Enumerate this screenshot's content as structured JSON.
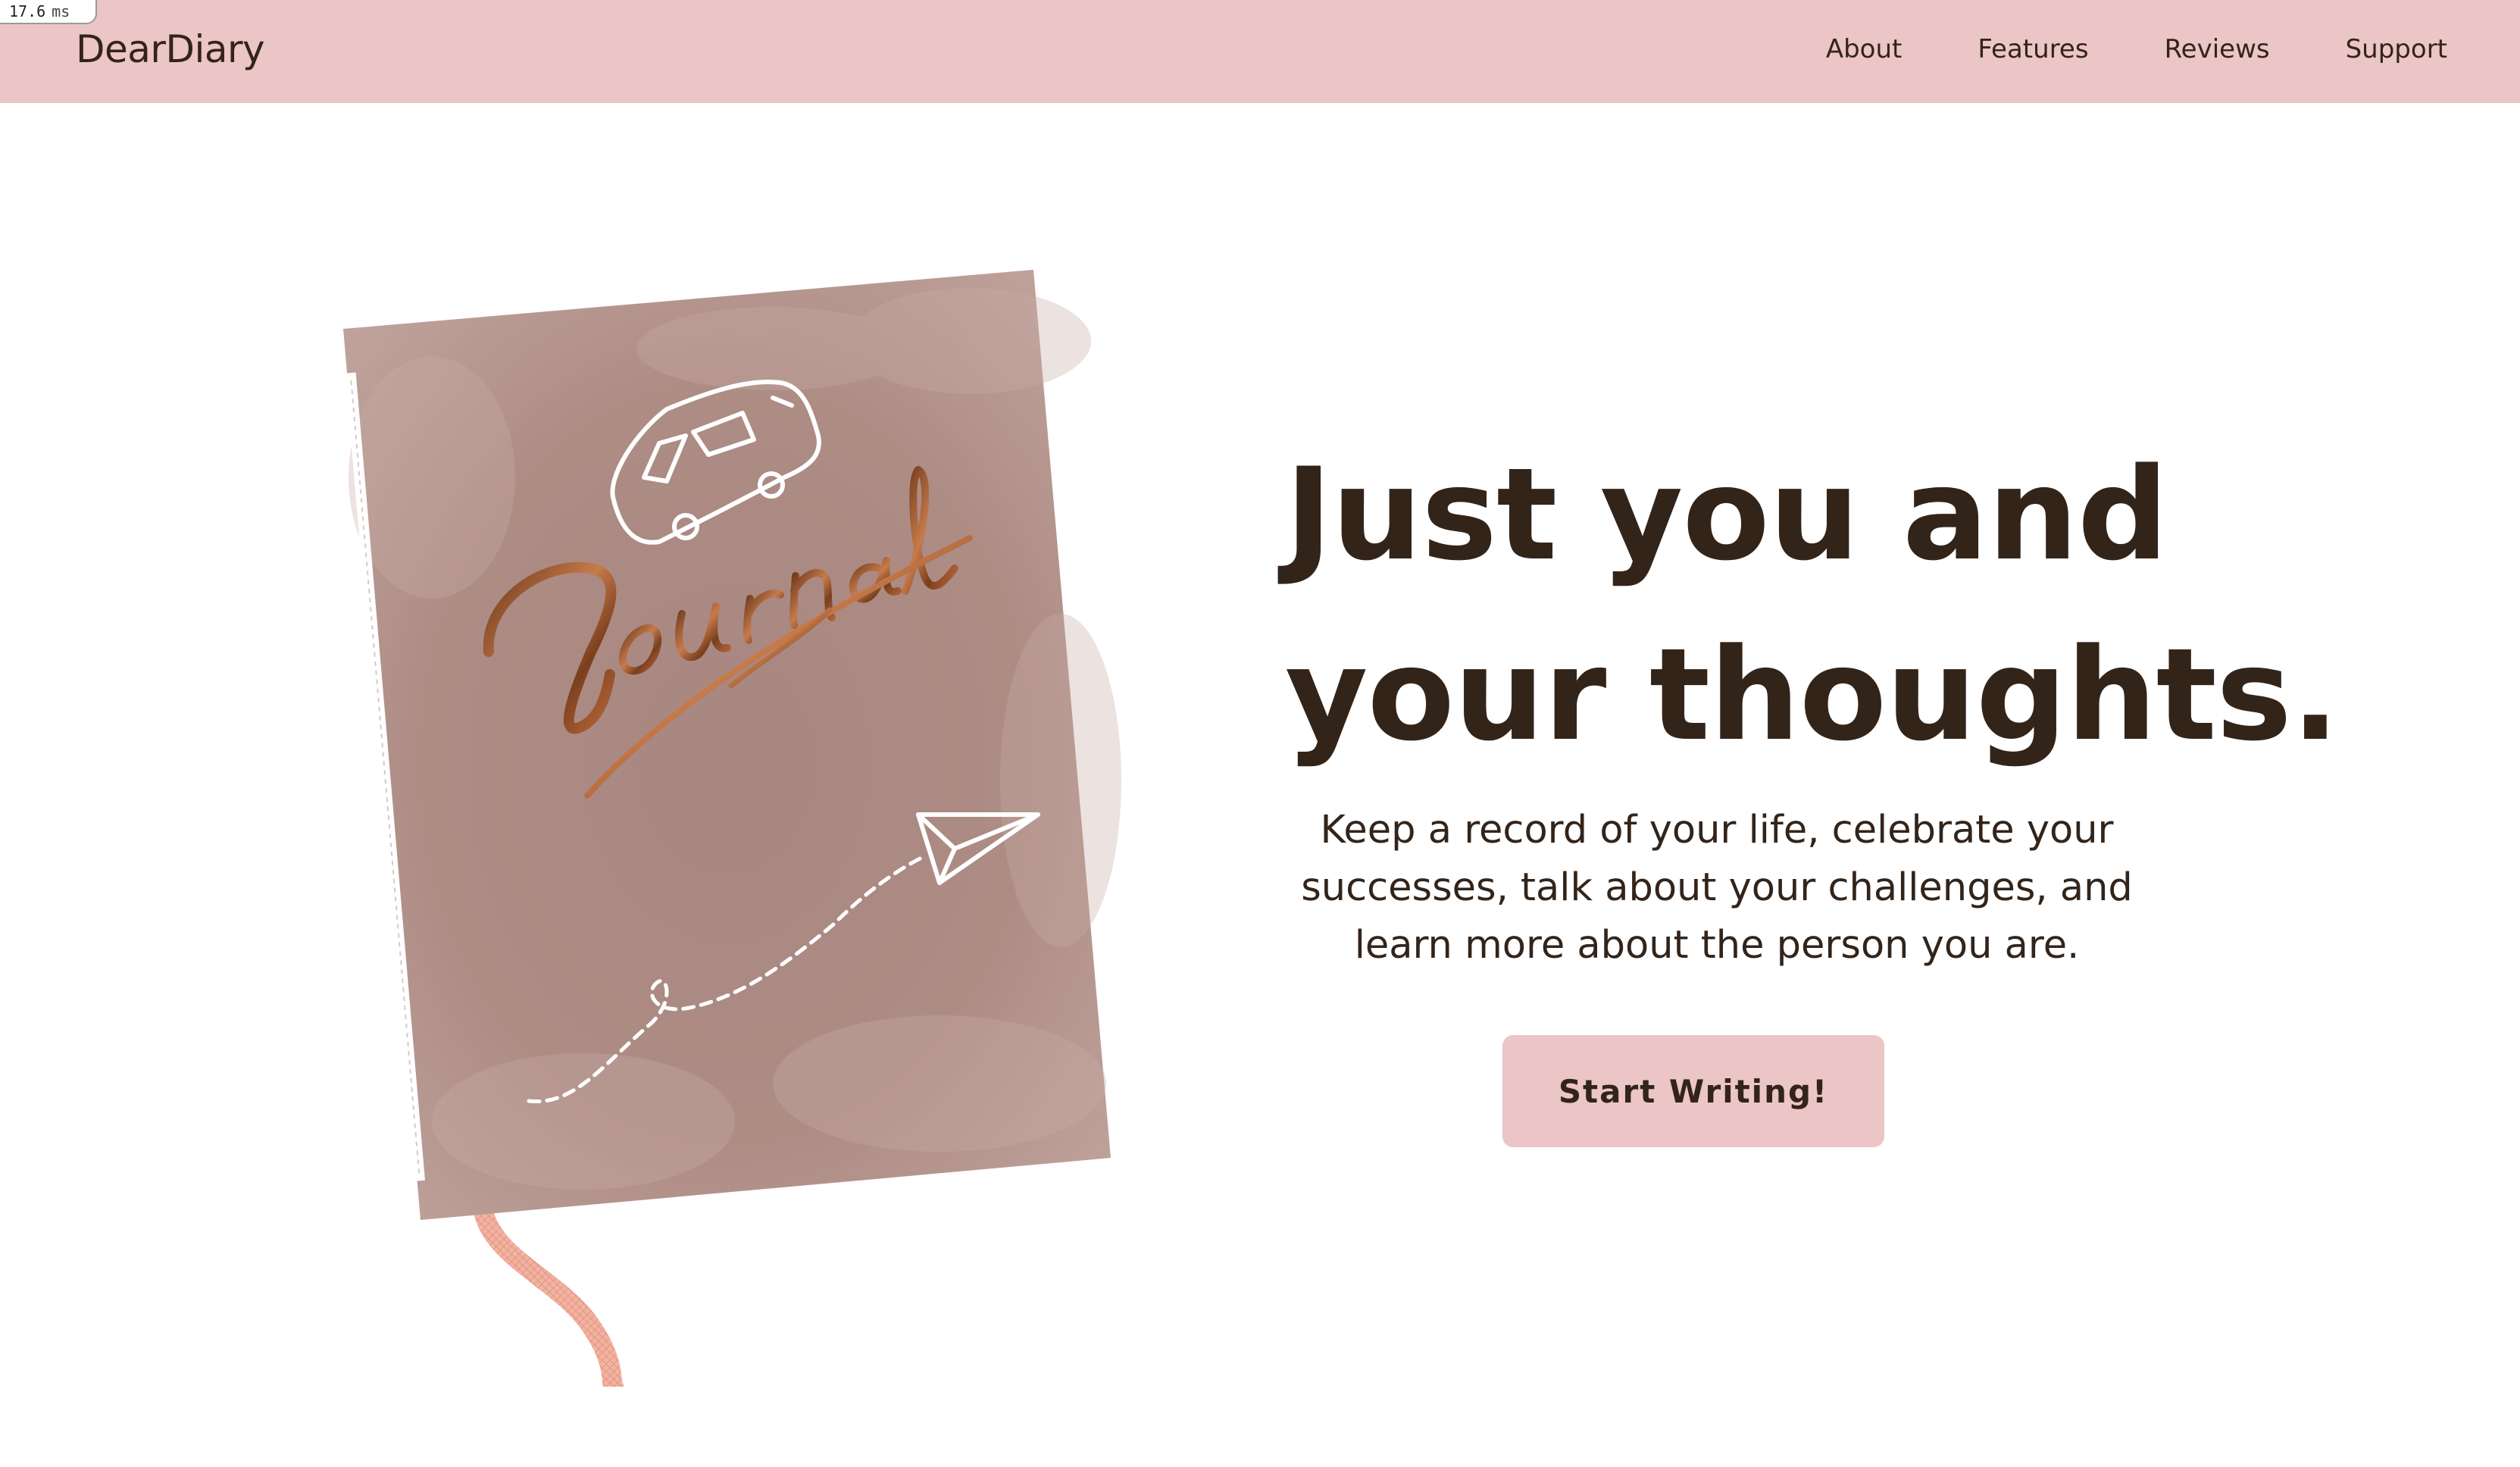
{
  "perf": {
    "value": "17.6",
    "unit": "ms"
  },
  "header": {
    "brand": "DearDiary",
    "nav": [
      "About",
      "Features",
      "Reviews",
      "Support"
    ]
  },
  "hero": {
    "title_line1": "Just you and",
    "title_line2": "your thoughts.",
    "subtitle": "Keep a record of your life, celebrate your successes, talk about your challenges, and learn more about the person you are.",
    "cta_label": "Start Writing!"
  },
  "illustration": {
    "cover_word": "Journal",
    "icons": [
      "van-icon",
      "paper-plane-icon",
      "bookmark-ribbon"
    ]
  },
  "colors": {
    "header_bg": "#ecc5c7",
    "text_dark": "#33241a",
    "journal_cover": "#ad8c84",
    "journal_accent": "#a45a32",
    "ribbon": "#f2b3a2"
  }
}
